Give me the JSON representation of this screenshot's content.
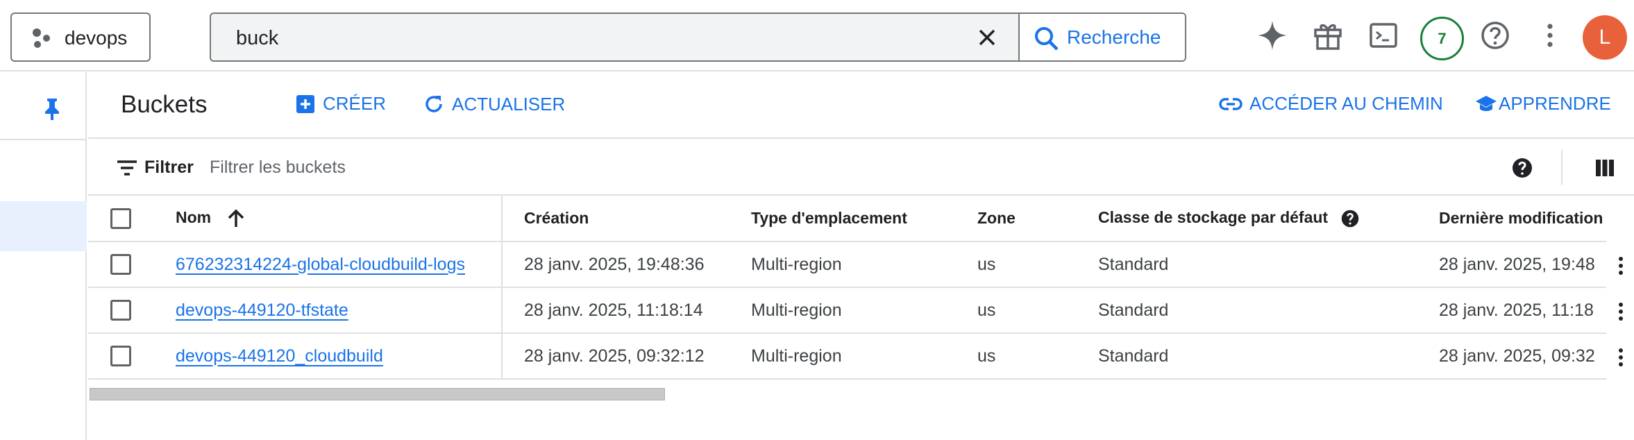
{
  "topbar": {
    "project_label": "devops",
    "search_value": "buck",
    "search_button_label": "Recherche",
    "notification_count": "7",
    "avatar_initial": "L",
    "icons": [
      "sparkle-icon",
      "gift-icon",
      "cloud-shell-icon",
      "help-icon",
      "more-vert-icon"
    ]
  },
  "header": {
    "title": "Buckets",
    "create_label": "CRÉER",
    "refresh_label": "ACTUALISER",
    "goto_path_label": "ACCÉDER AU CHEMIN",
    "learn_label": "APPRENDRE"
  },
  "filter": {
    "label": "Filtrer",
    "placeholder": "Filtrer les buckets"
  },
  "table": {
    "columns": [
      "Nom",
      "Création",
      "Type d'emplacement",
      "Zone",
      "Classe de stockage par défaut",
      "Dernière modification"
    ],
    "rows": [
      {
        "name": "676232314224-global-cloudbuild-logs",
        "created": "28 janv. 2025, 19:48:36",
        "location_type": "Multi-region",
        "zone": "us",
        "storage_class": "Standard",
        "modified": "28 janv. 2025, 19:48"
      },
      {
        "name": "devops-449120-tfstate",
        "created": "28 janv. 2025, 11:18:14",
        "location_type": "Multi-region",
        "zone": "us",
        "storage_class": "Standard",
        "modified": "28 janv. 2025, 11:18"
      },
      {
        "name": "devops-449120_cloudbuild",
        "created": "28 janv. 2025, 09:32:12",
        "location_type": "Multi-region",
        "zone": "us",
        "storage_class": "Standard",
        "modified": "28 janv. 2025, 09:32"
      }
    ]
  },
  "colors": {
    "accent": "#1a73e8",
    "badge_green": "#188038",
    "avatar_bg": "#e8613b",
    "pin_blue": "#1a73e8"
  }
}
